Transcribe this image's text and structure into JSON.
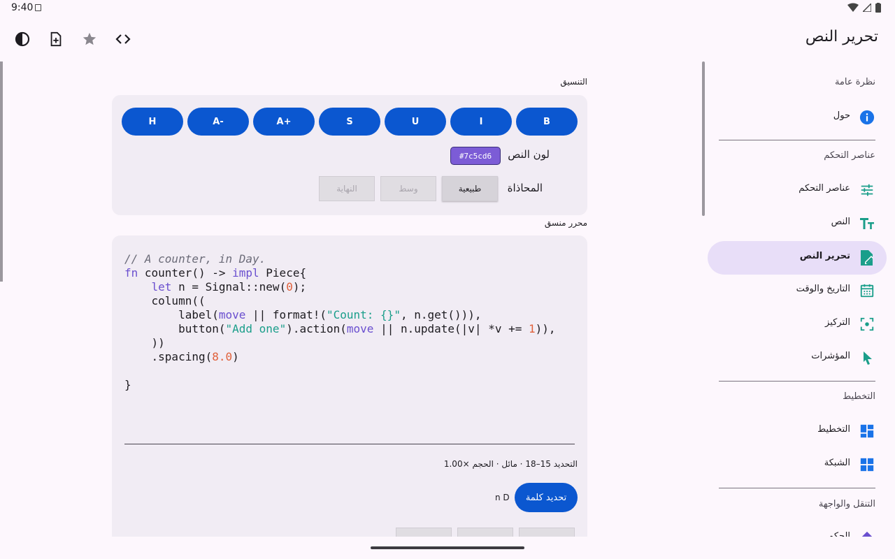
{
  "status_bar": {
    "time": "9:40"
  },
  "app_bar": {
    "title": "تحرير النص",
    "actions": [
      "theme-toggle-icon",
      "new-document-icon",
      "star-icon",
      "code-icon"
    ]
  },
  "sidebar": {
    "sections": [
      {
        "title": "نظرة عامة",
        "items": [
          {
            "label": "حول",
            "icon": "info-icon",
            "color": "#1a73e8"
          }
        ]
      },
      {
        "title": "عناصر التحكم",
        "items": [
          {
            "label": "عناصر التحكم",
            "icon": "tune-icon",
            "color": "#1a9e8a"
          },
          {
            "label": "النص",
            "icon": "text-fields-icon",
            "color": "#1a9e8a"
          },
          {
            "label": "تحرير النص",
            "icon": "edit-document-icon",
            "color": "#1a9e8a",
            "active": true
          },
          {
            "label": "التاريخ والوقت",
            "icon": "calendar-icon",
            "color": "#1a9e8a"
          },
          {
            "label": "التركيز",
            "icon": "focus-icon",
            "color": "#1a9e8a"
          },
          {
            "label": "المؤشرات",
            "icon": "pointer-icon",
            "color": "#1a9e8a"
          }
        ]
      },
      {
        "title": "التخطيط",
        "items": [
          {
            "label": "التخطيط",
            "icon": "layout-icon",
            "color": "#1a73e8"
          },
          {
            "label": "الشبكة",
            "icon": "grid-icon",
            "color": "#1a73e8"
          }
        ]
      },
      {
        "title": "التنقل والواجهة",
        "items": [
          {
            "label": "الحكم",
            "icon": "diamond-icon",
            "color": "#6a4fcf"
          }
        ]
      }
    ]
  },
  "formatting": {
    "section_label": "التنسيق",
    "buttons": [
      "B",
      "I",
      "U",
      "S",
      "A+",
      "A-",
      "H"
    ],
    "text_color_label": "لون النص",
    "text_color_value": "#7c5cd6",
    "alignment_label": "المحاذاة",
    "alignment_options": [
      "طبيعية",
      "وسط",
      "النهاية"
    ],
    "alignment_selected": "طبيعية"
  },
  "editor": {
    "section_label": "محرر منسق",
    "code_lines": [
      "// A counter, in Day.",
      "fn counter() -> impl Piece{",
      "    let n = Signal::new(0);",
      "    column((",
      "        label(move || format!(\"Count: {}\", n.get())),",
      "        button(\"Add one\").action(move || n.update(|v| *v += 1)),",
      "    ))",
      "    .spacing(8.0)",
      "",
      "}"
    ],
    "status_text": "التحديد 15–18 · مائل · الحجم ×1.00",
    "select_word_button": "تحديد كلمة",
    "nd_text": "n D"
  }
}
